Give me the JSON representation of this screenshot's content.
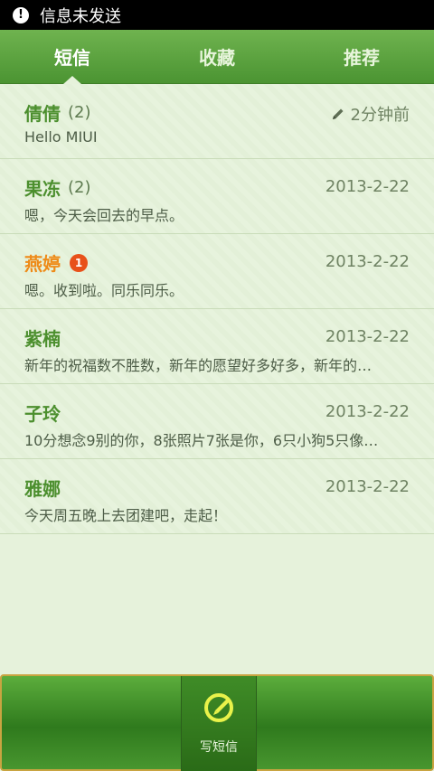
{
  "status_bar": {
    "alert_icon": "!",
    "notification": "信息未发送"
  },
  "tabs": [
    {
      "label": "短信",
      "active": true
    },
    {
      "label": "收藏",
      "active": false
    },
    {
      "label": "推荐",
      "active": false
    }
  ],
  "conversations": [
    {
      "name": "倩倩",
      "count": "(2)",
      "time": "2分钟前",
      "draft": true,
      "preview": "Hello MIUI",
      "unread": false
    },
    {
      "name": "果冻",
      "count": "(2)",
      "time": "2013-2-22",
      "draft": false,
      "preview": "嗯，今天会回去的早点。",
      "unread": false
    },
    {
      "name": "燕婷",
      "count": "",
      "badge": "1",
      "time": "2013-2-22",
      "draft": false,
      "preview": "嗯。收到啦。同乐同乐。",
      "unread": true
    },
    {
      "name": "紫楠",
      "count": "",
      "time": "2013-2-22",
      "draft": false,
      "preview": "新年的祝福数不胜数，新年的愿望好多好多，新年的…",
      "unread": false
    },
    {
      "name": "子玲",
      "count": "",
      "time": "2013-2-22",
      "draft": false,
      "preview": "10分想念9别的你，8张照片7张是你，6只小狗5只像…",
      "unread": false
    },
    {
      "name": "雅娜",
      "count": "",
      "time": "2013-2-22",
      "draft": false,
      "preview": "今天周五晚上去团建吧，走起！",
      "unread": false
    }
  ],
  "bottom": {
    "compose_label": "写短信",
    "compose_icon": "compose-icon"
  },
  "colors": {
    "accent": "#4c8f2e",
    "unread": "#ee8a17",
    "badge": "#e8511a"
  }
}
